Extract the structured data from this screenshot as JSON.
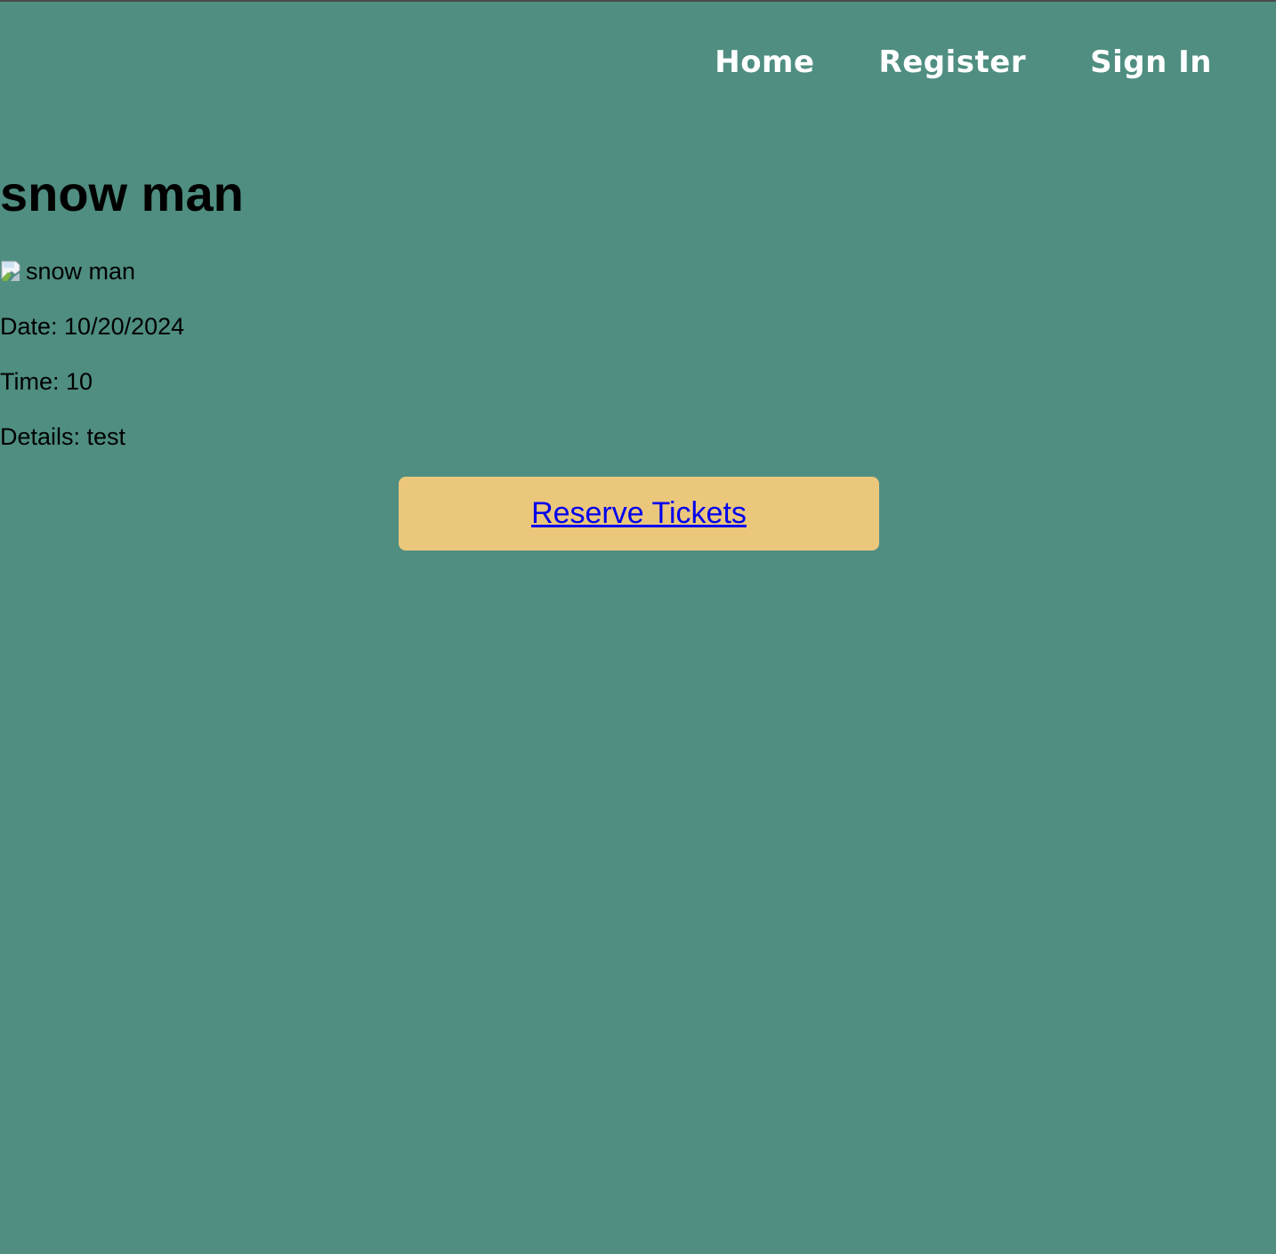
{
  "nav": {
    "items": [
      {
        "label": "Home"
      },
      {
        "label": "Register"
      },
      {
        "label": "Sign In"
      }
    ]
  },
  "event": {
    "title": "snow man",
    "image_alt": "snow man",
    "date_line": "Date: 10/20/2024",
    "time_line": "Time: 10",
    "details_line": "Details: test"
  },
  "actions": {
    "reserve_label": "Reserve Tickets"
  },
  "colors": {
    "background": "#4f8e81",
    "nav_text": "#ffffff",
    "button_bg": "#ebc77c",
    "link": "#0000ee"
  }
}
